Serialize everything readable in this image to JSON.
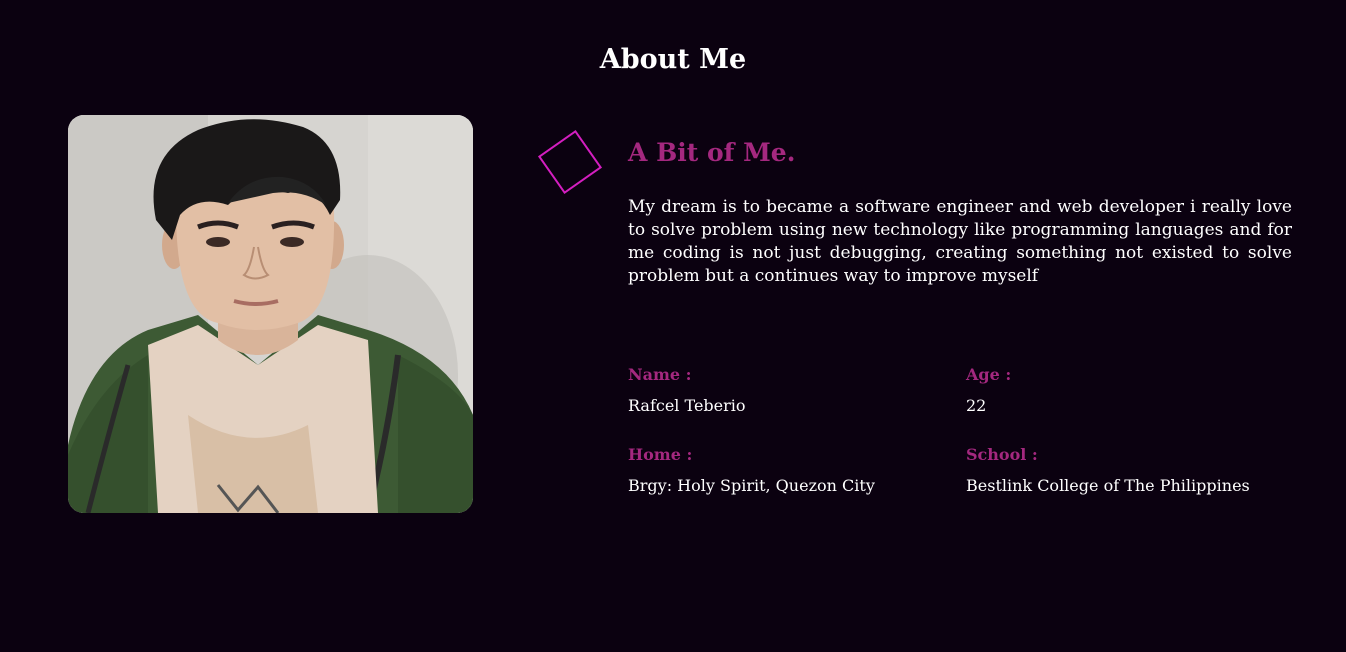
{
  "colors": {
    "background": "#0b0110",
    "accent": "#a4287f",
    "diamond_stroke": "#d41ec0",
    "text": "#ffffff"
  },
  "section": {
    "title": "About Me"
  },
  "photo": {
    "description_icon": "profile-photo"
  },
  "about": {
    "subtitle": "A Bit of Me.",
    "bio": "My dream is to became a software engineer and web developer i really love to solve problem using new technology like programming languages and for me coding is not just debugging, creating something not existed to solve problem but a continues way to improve myself"
  },
  "info": {
    "name": {
      "label": "Name :",
      "value": "Rafcel Teberio"
    },
    "age": {
      "label": "Age :",
      "value": "22"
    },
    "home": {
      "label": "Home :",
      "value": "Brgy: Holy Spirit, Quezon City"
    },
    "school": {
      "label": "School :",
      "value": "Bestlink College of The Philippines"
    }
  }
}
